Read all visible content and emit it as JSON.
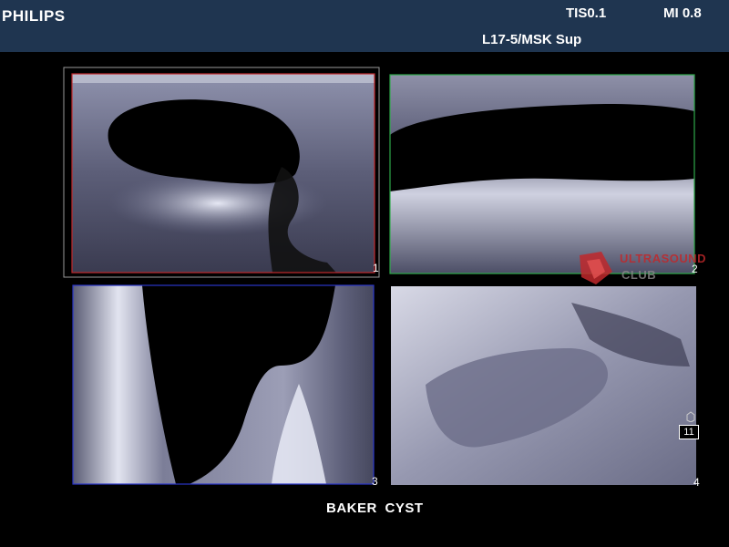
{
  "header": {
    "brand": "PHILIPS",
    "tis": "TIS0.1",
    "mi": "MI 0.8",
    "probe_preset": "L17-5/MSK Sup"
  },
  "panels": [
    {
      "number": "1",
      "border_color": "#c0282b"
    },
    {
      "number": "2",
      "border_color": "#2fa84a"
    },
    {
      "number": "3",
      "border_color": "#2a36c8"
    },
    {
      "number": "4",
      "border_color": "none"
    }
  ],
  "watermark": {
    "line1": "ULTRASOUND",
    "line2": "CLUB"
  },
  "slice_indicator": "11",
  "caption": "BAKER  CYST"
}
